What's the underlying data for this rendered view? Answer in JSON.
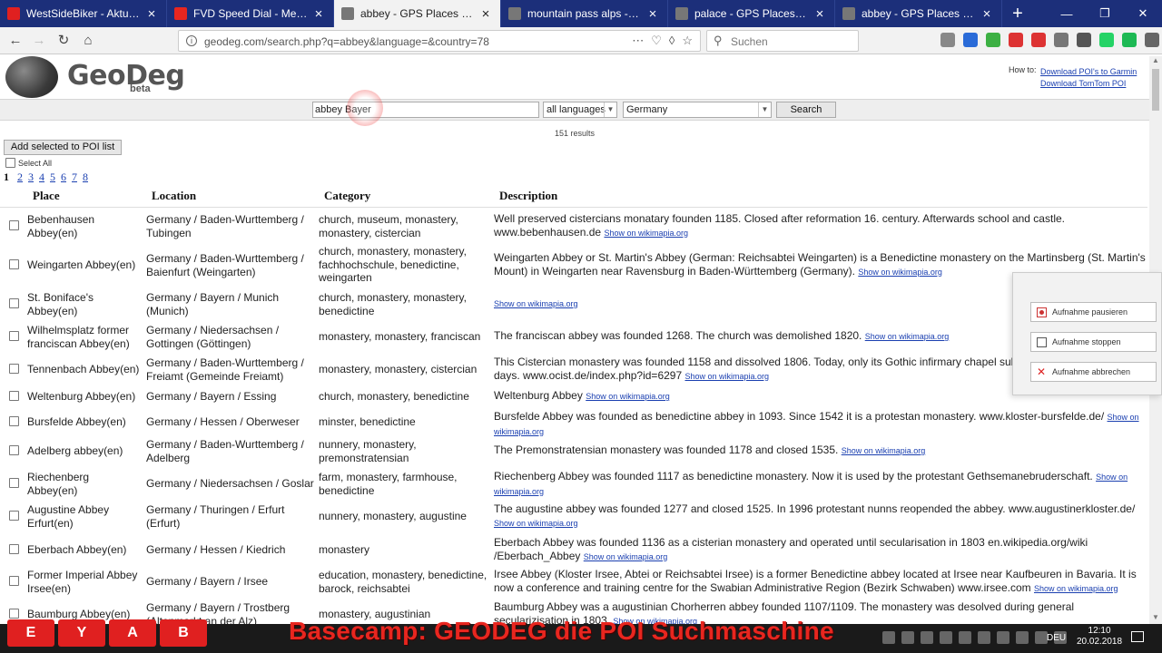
{
  "browser": {
    "tabs": [
      {
        "title": "WestSideBiker - Aktuelle Ther",
        "color": "#e02020",
        "active": false
      },
      {
        "title": "FVD Speed Dial - Meine Biker",
        "color": "#e8261f",
        "active": false
      },
      {
        "title": "abbey - GPS Places and POI in",
        "color": "#777777",
        "active": true
      },
      {
        "title": "mountain pass alps - GPS Plac",
        "color": "#777777",
        "active": false
      },
      {
        "title": "palace - GPS Places and POI",
        "color": "#777777",
        "active": false
      },
      {
        "title": "abbey - GPS Places and POI in",
        "color": "#777777",
        "active": false
      }
    ],
    "url": "geodeg.com/search.php?q=abbey&language=&country=78",
    "search_placeholder": "Suchen"
  },
  "site": {
    "logo": "GeoDeg",
    "logo_sub": "beta",
    "howto_label": "How to:",
    "howto_links": [
      "Download POI's to Garmin",
      "Download TomTom POI"
    ]
  },
  "search": {
    "query": "abbey Bayer",
    "language": "all languages",
    "country": "Germany",
    "button": "Search",
    "results": "151 results"
  },
  "list": {
    "add_button": "Add selected to POI list",
    "select_all": "Select All",
    "current_page": "1",
    "pages": [
      "2",
      "3",
      "4",
      "5",
      "6",
      "7",
      "8"
    ],
    "headers": {
      "place": "Place",
      "location": "Location",
      "category": "Category",
      "description": "Description"
    },
    "wikimapia": "Show on wikimapia.org",
    "rows": [
      {
        "place": "Bebenhausen Abbey(en)",
        "location": "Germany / Baden-Wurttemberg / Tubingen",
        "category": "church, museum, monastery, monastery, cistercian",
        "description": "Well preserved cistercians monatary founden 1185. Closed after reformation 16. century. Afterwards school and castle. www.bebenhausen.de"
      },
      {
        "place": "Weingarten Abbey(en)",
        "location": "Germany / Baden-Wurttemberg / Baienfurt (Weingarten)",
        "category": "church, monastery, monastery, fachhochschule, benedictine, weingarten",
        "description": "Weingarten Abbey or St. Martin's Abbey (German: Reichsabtei Weingarten) is a Benedictine monastery on the Martinsberg (St. Martin's Mount) in Weingarten near Ravensburg in Baden-Württemberg (Germany)."
      },
      {
        "place": "St. Boniface's Abbey(en)",
        "location": "Germany / Bayern / Munich (Munich)",
        "category": "church, monastery, monastery, benedictine",
        "description": ""
      },
      {
        "place": "Wilhelmsplatz former franciscan Abbey(en)",
        "location": "Germany / Niedersachsen / Gottingen (Göttingen)",
        "category": "monastery, monastery, franciscan",
        "description": "The franciscan abbey was founded 1268. The church was demolished 1820."
      },
      {
        "place": "Tennenbach Abbey(en)",
        "location": "Germany / Baden-Wurttemberg / Freiamt (Gemeinde Freiamt)",
        "category": "monastery, monastery, cistercian",
        "description": "This Cistercian monastery was founded 1158 and dissolved 1806. Today, only its Gothic infirmary chapel subsis are held on high feast days. www.ocist.de/index.php?id=6297"
      },
      {
        "place": "Weltenburg Abbey(en)",
        "location": "Germany / Bayern / Essing",
        "category": "church, monastery, benedictine",
        "description": "Weltenburg Abbey"
      },
      {
        "place": "Bursfelde Abbey(en)",
        "location": "Germany / Hessen / Oberweser",
        "category": "minster, benedictine",
        "description": "Bursfelde Abbey was founded as benedictine abbey in 1093. Since 1542 it is a protestan monastery. www.kloster-bursfelde.de/"
      },
      {
        "place": "Adelberg abbey(en)",
        "location": "Germany / Baden-Wurttemberg / Adelberg",
        "category": "nunnery, monastery, premonstratensian",
        "description": "The Premonstratensian monastery was founded 1178 and closed 1535."
      },
      {
        "place": "Riechenberg Abbey(en)",
        "location": "Germany / Niedersachsen / Goslar",
        "category": "farm, monastery, farmhouse, benedictine",
        "description": "Riechenberg Abbey was founded 1117 as benedictine monastery. Now it is used by the protestant Gethsemanebruderschaft."
      },
      {
        "place": "Augustine Abbey Erfurt(en)",
        "location": "Germany / Thuringen / Erfurt (Erfurt)",
        "category": "nunnery, monastery, augustine",
        "description": "The augustine abbey was founded 1277 and closed 1525. In 1996 protestant nunns reopended the abbey. www.augustinerkloster.de/"
      },
      {
        "place": "Eberbach Abbey(en)",
        "location": "Germany / Hessen / Kiedrich",
        "category": "monastery",
        "description": "Eberbach Abbey was founded 1136 as a cisterian monastery and operated until secularisation in 1803 en.wikipedia.org/wiki /Eberbach_Abbey"
      },
      {
        "place": "Former Imperial Abbey Irsee(en)",
        "location": "Germany / Bayern / Irsee",
        "category": "education, monastery, benedictine, barock, reichsabtei",
        "description": "Irsee Abbey (Kloster Irsee, Abtei or Reichsabtei Irsee) is a former Benedictine abbey located at Irsee near Kaufbeuren in Bavaria. It is now a conference and training centre for the Swabian Administrative Region (Bezirk Schwaben) www.irsee.com"
      },
      {
        "place": "Baumburg Abbey(en)",
        "location": "Germany / Bayern / Trostberg (Altenmarkt an der Alz)",
        "category": "monastery, augustinian",
        "description": "Baumburg Abbey was a augustinian Chorherren abbey founded 1107/1109. The monastery was desolved during general secularizisation in 1803."
      }
    ]
  },
  "recorder": {
    "pause": "Aufnahme pausieren",
    "stop": "Aufnahme stoppen",
    "cancel": "Aufnahme abbrechen"
  },
  "taskbar": {
    "overlay_title": "Basecamp: GEODEG  die POI Suchmaschine",
    "tiles": [
      "E",
      "Y",
      "A",
      "B"
    ],
    "language": "DEU",
    "time": "12:10",
    "date": "20.02.2018"
  }
}
